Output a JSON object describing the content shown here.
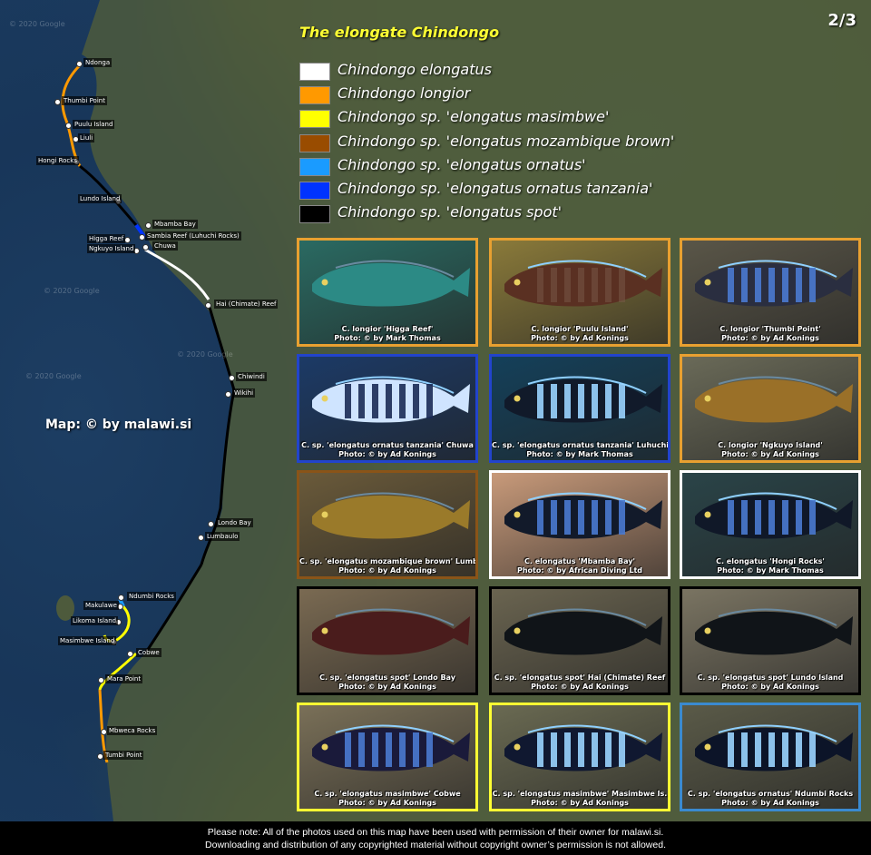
{
  "title": "The elongate Chindongo",
  "page_indicator": "2/3",
  "map_credit": "Map: © by malawi.si",
  "watermark": "© 2020 Google",
  "legend": [
    {
      "label": "Chindongo elongatus",
      "color": "#ffffff"
    },
    {
      "label": "Chindongo longior",
      "color": "#ff9900"
    },
    {
      "label": "Chindongo sp. 'elongatus masimbwe'",
      "color": "#ffff00"
    },
    {
      "label": "Chindongo sp. 'elongatus mozambique brown'",
      "color": "#994c00"
    },
    {
      "label": "Chindongo sp. 'elongatus ornatus'",
      "color": "#1a9bff"
    },
    {
      "label": "Chindongo sp. 'elongatus ornatus tanzania'",
      "color": "#0033ff"
    },
    {
      "label": "Chindongo sp. 'elongatus spot'",
      "color": "#000000"
    }
  ],
  "places": [
    {
      "name": "Ndonga"
    },
    {
      "name": "Thumbi Point"
    },
    {
      "name": "Puulu Island"
    },
    {
      "name": "Liuli"
    },
    {
      "name": "Hongi Rocks"
    },
    {
      "name": "Lundo Island"
    },
    {
      "name": "Mbamba Bay"
    },
    {
      "name": "Sambia Reef (Luhuchi Rocks)"
    },
    {
      "name": "Higga Reef"
    },
    {
      "name": "Chuwa"
    },
    {
      "name": "Ngkuyo Island"
    },
    {
      "name": "Hai (Chimate) Reef"
    },
    {
      "name": "Chiwindi"
    },
    {
      "name": "Wikihi"
    },
    {
      "name": "Londo Bay"
    },
    {
      "name": "Lumbaulo"
    },
    {
      "name": "Ndumbi Rocks"
    },
    {
      "name": "Makulawe"
    },
    {
      "name": "Likoma Island"
    },
    {
      "name": "Masimbwe Island"
    },
    {
      "name": "Cobwe"
    },
    {
      "name": "Mara Point"
    },
    {
      "name": "Mbweca Rocks"
    },
    {
      "name": "Tumbi Point"
    }
  ],
  "photos": [
    {
      "line1": "C. longior 'Higga Reef'",
      "line2": "Photo: © by Mark Thomas",
      "border": "#e8a030",
      "bg": "#2a6a62",
      "fish": "#2c8a85",
      "stripes": "none"
    },
    {
      "line1": "C. longior 'Puulu Island'",
      "line2": "Photo: © by Ad Konings",
      "border": "#e8a030",
      "bg": "#8a7a3a",
      "fish": "#5a3022",
      "stripes": "faint"
    },
    {
      "line1": "C. longior 'Thumbi Point'",
      "line2": "Photo: © by Ad Konings",
      "border": "#e8a030",
      "bg": "#5a5648",
      "fish": "#2a2e40",
      "stripes": "blue"
    },
    {
      "line1": "C. sp. 'elongatus ornatus tanzania' Chuwa",
      "line2": "Photo: © by Ad Konings",
      "border": "#2244cc",
      "bg": "#1c3a66",
      "fish": "#cfe4ff",
      "stripes": "dark"
    },
    {
      "line1": "C. sp. 'elongatus ornatus tanzania' Luhuchi",
      "line2": "Photo: © by Mark Thomas",
      "border": "#2244cc",
      "bg": "#14405a",
      "fish": "#111a2a",
      "stripes": "bright"
    },
    {
      "line1": "C. longior 'Ngkuyo Island'",
      "line2": "Photo: © by Ad Konings",
      "border": "#e8a030",
      "bg": "#6a6a58",
      "fish": "#9a7028",
      "stripes": "none"
    },
    {
      "line1": "C. sp. 'elongatus mozambique brown' Lumbaulo",
      "line2": "Photo: © by Ad Konings",
      "border": "#8a5418",
      "bg": "#6a5a3a",
      "fish": "#9a7a2a",
      "stripes": "none"
    },
    {
      "line1": "C. elongatus 'Mbamba Bay'",
      "line2": "Photo: © by African Diving Ltd",
      "border": "#ffffff",
      "bg": "#c89a7a",
      "fish": "#121a2a",
      "stripes": "blue"
    },
    {
      "line1": "C. elongatus 'Hongi Rocks'",
      "line2": "Photo: © by Mark Thomas",
      "border": "#ffffff",
      "bg": "#2a4448",
      "fish": "#101828",
      "stripes": "blue"
    },
    {
      "line1": "C. sp. 'elongatus spot' Londo Bay",
      "line2": "Photo: © by Ad Konings",
      "border": "#000000",
      "bg": "#7a6a52",
      "fish": "#4a1c1c",
      "stripes": "none"
    },
    {
      "line1": "C. sp. 'elongatus spot' Hai (Chimate) Reef",
      "line2": "Photo: © by Ad Konings",
      "border": "#000000",
      "bg": "#6a6450",
      "fish": "#101418",
      "stripes": "none"
    },
    {
      "line1": "C. sp. 'elongatus spot' Lundo Island",
      "line2": "Photo: © by Ad Konings",
      "border": "#000000",
      "bg": "#7a7462",
      "fish": "#101418",
      "stripes": "none"
    },
    {
      "line1": "C. sp. 'elongatus masimbwe' Cobwe",
      "line2": "Photo: © by Ad Konings",
      "border": "#ffff33",
      "bg": "#7a7058",
      "fish": "#1a1a3a",
      "stripes": "blue"
    },
    {
      "line1": "C. sp. 'elongatus masimbwe' Masimbwe Is.",
      "line2": "Photo: © by Ad Konings",
      "border": "#ffff33",
      "bg": "#6a6a52",
      "fish": "#101830",
      "stripes": "bright"
    },
    {
      "line1": "C. sp. 'elongatus ornatus' Ndumbi Rocks",
      "line2": "Photo: © by Ad Konings",
      "border": "#3a8ad0",
      "bg": "#5a5a48",
      "fish": "#0c1428",
      "stripes": "bright"
    }
  ],
  "footer": {
    "line1": "Please note: All of the photos used on this map have been used with permission of their owner for malawi.si.",
    "line2": "Downloading and distribution of any copyrighted material without copyright owner’s permission is not allowed."
  }
}
